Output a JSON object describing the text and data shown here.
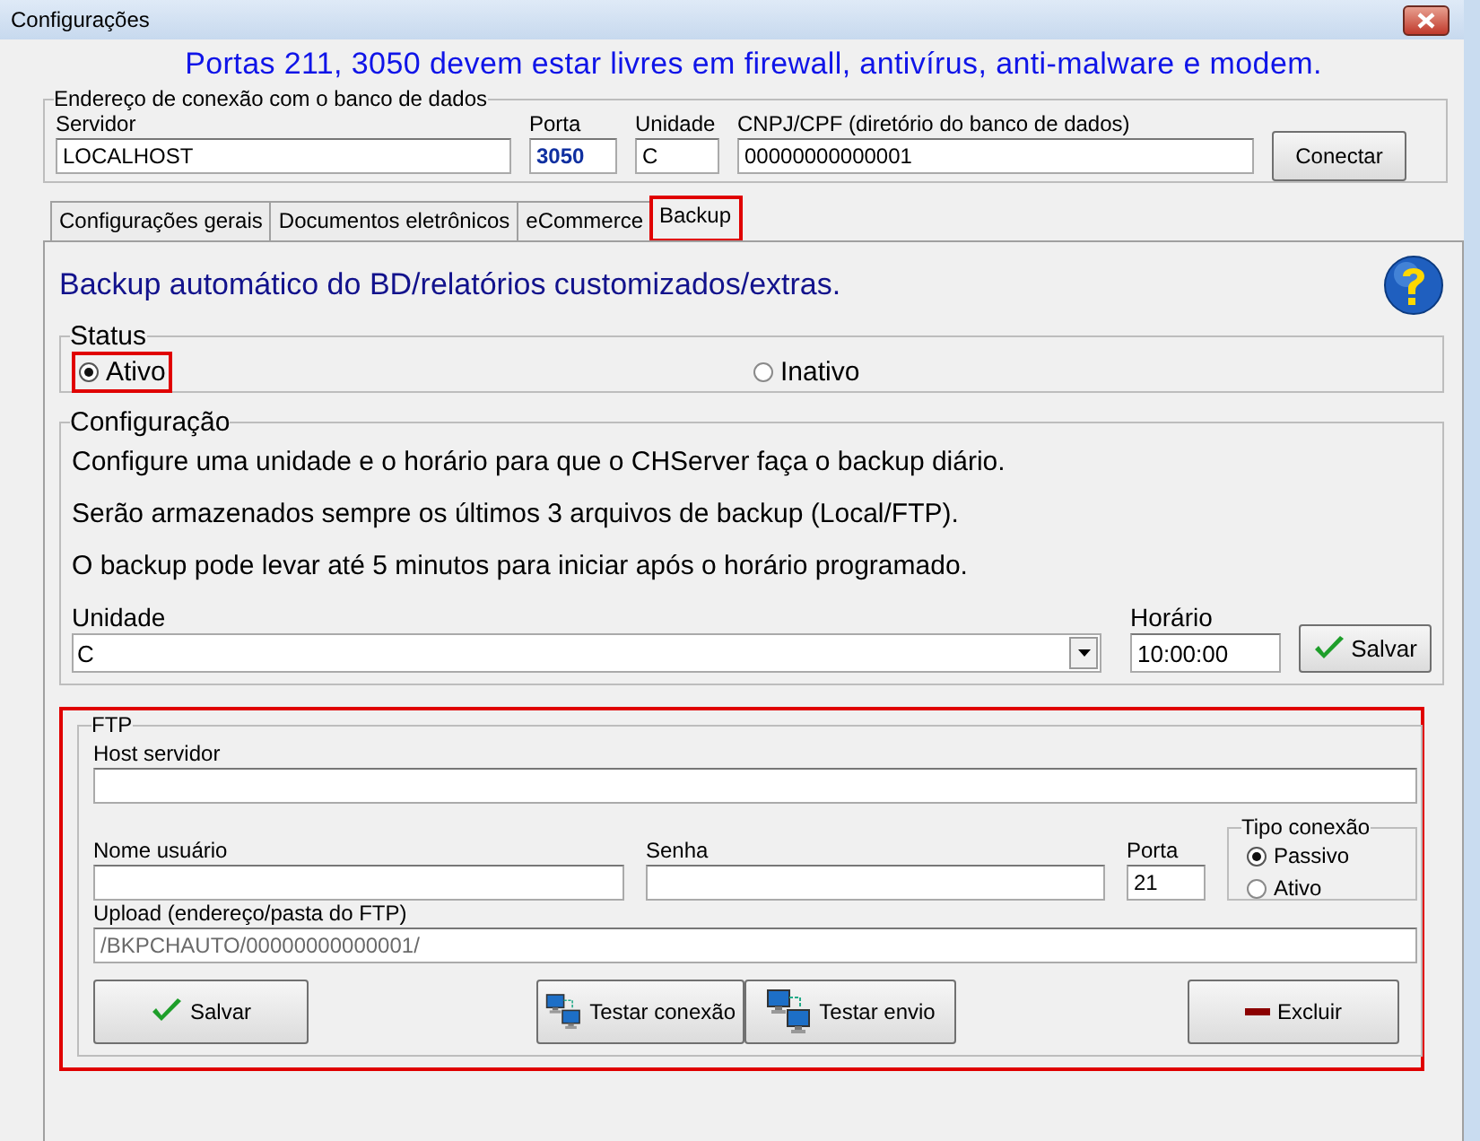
{
  "window": {
    "title": "Configurações"
  },
  "banner": "Portas 211, 3050 devem estar livres em firewall, antivírus, anti-malware e modem.",
  "connection": {
    "legend": "Endereço de conexão com o banco de dados",
    "fields": [
      {
        "label": "Servidor",
        "value": "LOCALHOST"
      },
      {
        "label": "Porta",
        "value": "3050"
      },
      {
        "label": "Unidade",
        "value": "C"
      },
      {
        "label": "CNPJ/CPF (diretório do banco de dados)",
        "value": "00000000000001"
      }
    ],
    "button": "Conectar"
  },
  "tabs": [
    {
      "label": "Configurações gerais",
      "selected": false,
      "highlighted": false
    },
    {
      "label": "Documentos eletrônicos",
      "selected": false,
      "highlighted": false
    },
    {
      "label": "eCommerce",
      "selected": false,
      "highlighted": false
    },
    {
      "label": "Backup",
      "selected": true,
      "highlighted": true
    }
  ],
  "backup": {
    "heading": "Backup automático do BD/relatórios customizados/extras.",
    "status": {
      "legend": "Status",
      "options": [
        {
          "label": "Ativo",
          "selected": true,
          "highlighted": true
        },
        {
          "label": "Inativo",
          "selected": false,
          "highlighted": false
        }
      ]
    },
    "config": {
      "legend": "Configuração",
      "lines": [
        "Configure uma unidade e o horário para que o CHServer faça o backup diário.",
        "Serão armazenados sempre os últimos 3 arquivos de backup (Local/FTP).",
        "O backup pode levar até 5 minutos para iniciar após o horário programado."
      ],
      "unit": {
        "label": "Unidade",
        "value": "C"
      },
      "time": {
        "label": "Horário",
        "value": "10:00:00"
      },
      "save": "Salvar"
    },
    "ftp": {
      "legend": "FTP",
      "highlighted": true,
      "host": {
        "label": "Host servidor"
      },
      "user": {
        "label": "Nome usuário"
      },
      "password": {
        "label": "Senha"
      },
      "port": {
        "label": "Porta",
        "value": "21"
      },
      "connection_type": {
        "legend": "Tipo conexão",
        "options": [
          {
            "label": "Passivo",
            "selected": true
          },
          {
            "label": "Ativo",
            "selected": false
          }
        ]
      },
      "upload": {
        "label": "Upload (endereço/pasta do FTP)",
        "value": "/BKPCHAUTO/00000000000001/",
        "disabled": true
      },
      "buttons": [
        {
          "kind": "save",
          "label": "Salvar"
        },
        {
          "kind": "test",
          "label": "Testar conexão"
        },
        {
          "kind": "test",
          "label": "Testar envio"
        },
        {
          "kind": "delete",
          "label": "Excluir"
        }
      ]
    }
  }
}
